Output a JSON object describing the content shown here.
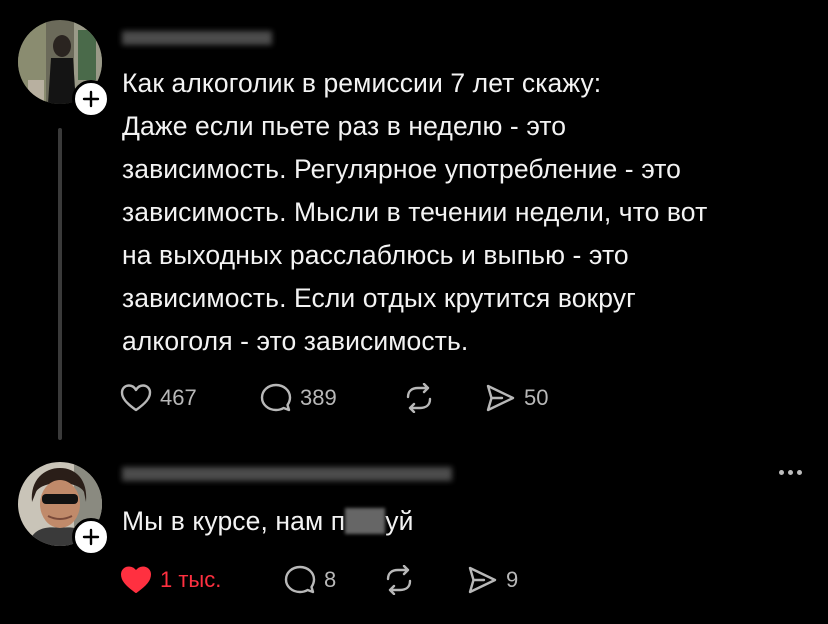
{
  "post1": {
    "username": "",
    "text_lines": [
      "Как алкоголик в ремиссии 7 лет скажу:",
      "Даже если пьете раз в неделю - это",
      "зависимость. Регулярное употребление - это",
      "зависимость. Мысли в течении недели, что вот",
      "на выходных расслаблюсь и выпью - это",
      "зависимость. Если отдых крутится вокруг",
      "алкоголя - это зависимость."
    ],
    "likes": "467",
    "replies": "389",
    "reposts": "",
    "shares": "50",
    "liked": false
  },
  "post2": {
    "username": "",
    "text_before": "Мы в курсе, нам п",
    "text_after": "уй",
    "likes": "1 тыс.",
    "replies": "8",
    "reposts": "",
    "shares": "9",
    "liked": true
  },
  "colors": {
    "background": "#000000",
    "text": "#f3f3f3",
    "secondary": "#b8b8b8",
    "like_red": "#ff3040",
    "thread_line": "#3a3a3a"
  },
  "icons": {
    "like": "heart-icon",
    "reply": "speech-bubble-icon",
    "repost": "repost-icon",
    "share": "send-icon",
    "follow": "plus-icon",
    "more": "more-dots-icon"
  }
}
